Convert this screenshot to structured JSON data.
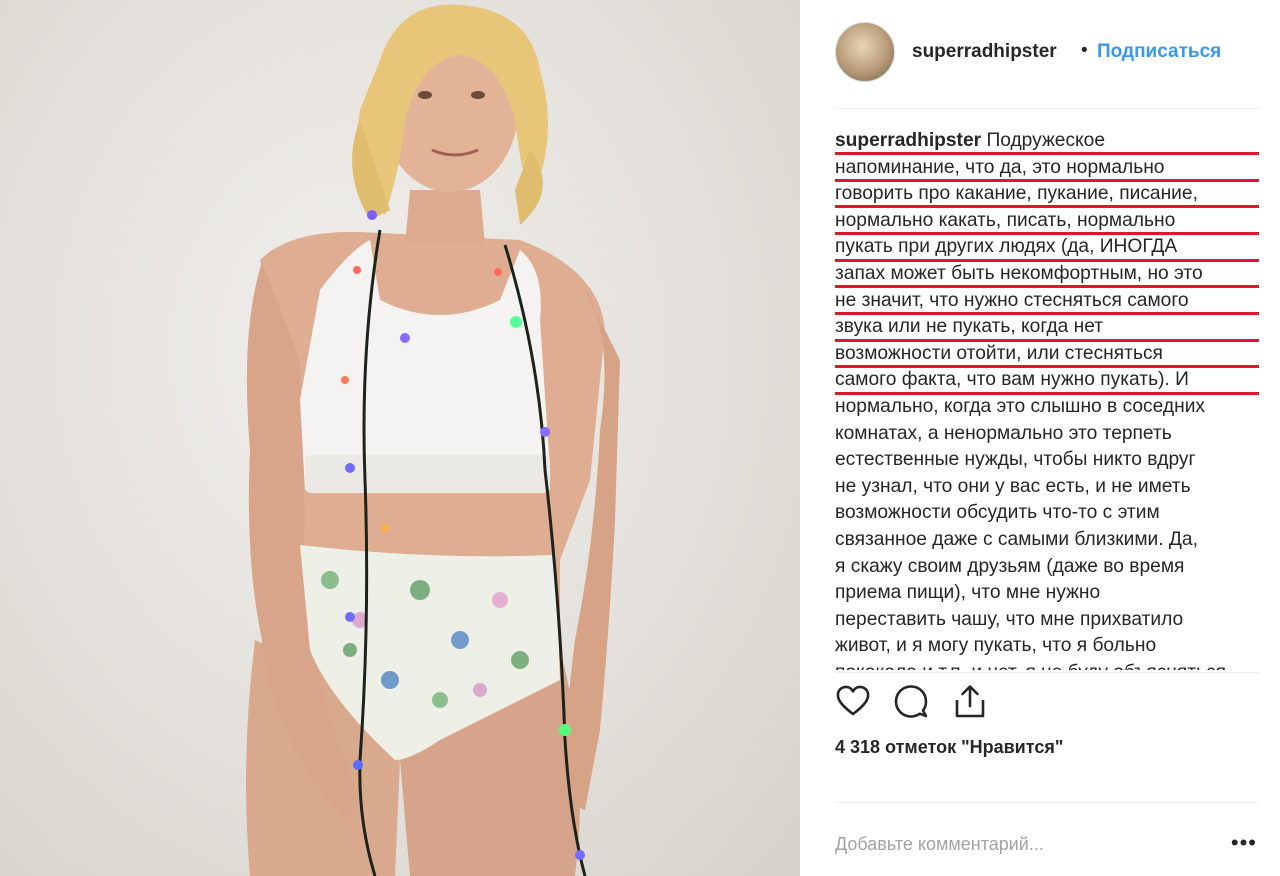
{
  "post": {
    "username": "superradhipster",
    "separator": "•",
    "follow_label": "Подписаться",
    "caption_user": "superradhipster",
    "caption_lines": [
      "Подружеское",
      "напоминание, что да, это нормально",
      "говорить про какание, пукание, писание,",
      "нормально какать, писать, нормально",
      "пукать при других людях (да, ИНОГДА",
      "запах может быть некомфортным, но это",
      "не значит, что нужно стесняться самого",
      "звука или не пукать, когда нет",
      "возможности отойти, или стесняться",
      "самого факта, что вам нужно пукать). И",
      "нормально, когда это слышно в соседних",
      "комнатах, а ненормально это терпеть",
      "естественные нужды, чтобы никто вдруг",
      "не узнал, что они у вас есть, и не иметь",
      "возможности обсудить что-то с этим",
      "связанное даже с самыми близкими. Да,",
      "я скажу своим друзьям (даже во время",
      "приема пищи), что мне нужно",
      "переставить чашу, что мне прихватило",
      "живот, и я могу пукать, что я больно",
      "покакала и т.п. и нет, я не буду объясняться"
    ],
    "likes_text": "4 318 отметок \"Нравится\"",
    "comment_placeholder": "Добавьте комментарий...",
    "more_label": "•••",
    "accent_color": "#3897f0",
    "underline_color": "#e0162b"
  },
  "icons": {
    "like": "heart-icon",
    "comment": "comment-bubble-icon",
    "share": "share-icon",
    "more": "more-options-icon"
  }
}
